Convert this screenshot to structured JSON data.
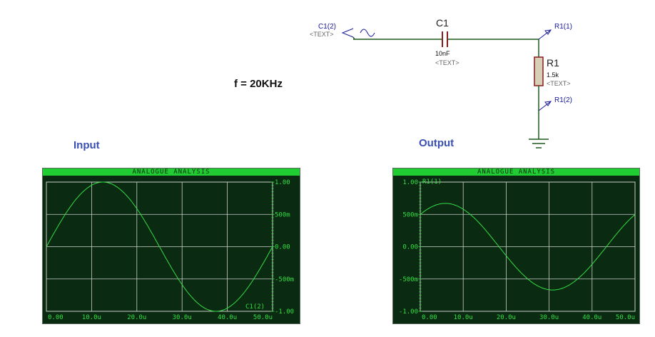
{
  "schematic": {
    "source_ref": "C1(2)",
    "source_text": "<TEXT>",
    "cap_ref": "C1",
    "cap_value": "10nF",
    "cap_text": "<TEXT>",
    "probe_top": "R1(1)",
    "res_ref": "R1",
    "res_value": "1.5k",
    "res_text": "<TEXT>",
    "probe_bottom": "R1(2)"
  },
  "frequency_label": "f = 20KHz",
  "input_title": "Input",
  "output_title": "Output",
  "colors": {
    "trace": "#33dd44",
    "graph_bg": "#0b2a12",
    "title_bar": "#22cc33",
    "wire": "#1d5a1d",
    "component": "#8b1a1a"
  },
  "chart_data": [
    {
      "type": "line",
      "title": "ANALOGUE ANALYSIS",
      "trace_label": "C1(2)",
      "x_ticks": [
        "0.00",
        "10.0u",
        "20.0u",
        "30.0u",
        "40.0u",
        "50.0u"
      ],
      "y_ticks": [
        "1.00",
        "500m",
        "0.00",
        "-500m",
        "-1.00"
      ],
      "y_axis_side": "right",
      "xlim": [
        0,
        50
      ],
      "ylim": [
        -1,
        1
      ],
      "grid": true,
      "series": [
        {
          "amplitude": 1.0,
          "frequency_khz": 20,
          "phase_deg": 0,
          "x": [
            0,
            5,
            10,
            12.5,
            15,
            20,
            25,
            30,
            35,
            37.5,
            40,
            45,
            50
          ],
          "y": [
            0,
            0.59,
            0.95,
            1.0,
            0.95,
            0.59,
            0,
            -0.59,
            -0.95,
            -1.0,
            -0.95,
            -0.59,
            0
          ]
        }
      ]
    },
    {
      "type": "line",
      "title": "ANALOGUE ANALYSIS",
      "trace_label": "R1(1)",
      "x_ticks": [
        "0.00",
        "10.0u",
        "20.0u",
        "30.0u",
        "40.0u",
        "50.0u"
      ],
      "y_ticks": [
        "1.00",
        "500m",
        "0.00",
        "-500m",
        "-1.00"
      ],
      "y_axis_side": "left",
      "xlim": [
        0,
        50
      ],
      "ylim": [
        -1,
        1
      ],
      "grid": true,
      "series": [
        {
          "amplitude": 0.67,
          "frequency_khz": 20,
          "phase_deg": 48,
          "x": [
            0,
            3.3,
            6.6,
            9.9,
            13.2,
            16.5,
            19.9,
            23.2,
            26.5,
            29.8,
            33.2,
            36.5,
            39.8,
            43.1,
            46.4,
            50
          ],
          "y": [
            0.5,
            0.66,
            0.62,
            0.41,
            0.09,
            -0.25,
            -0.51,
            -0.66,
            -0.62,
            -0.41,
            -0.09,
            0.25,
            0.51,
            0.66,
            0.62,
            0.5
          ]
        }
      ]
    }
  ]
}
